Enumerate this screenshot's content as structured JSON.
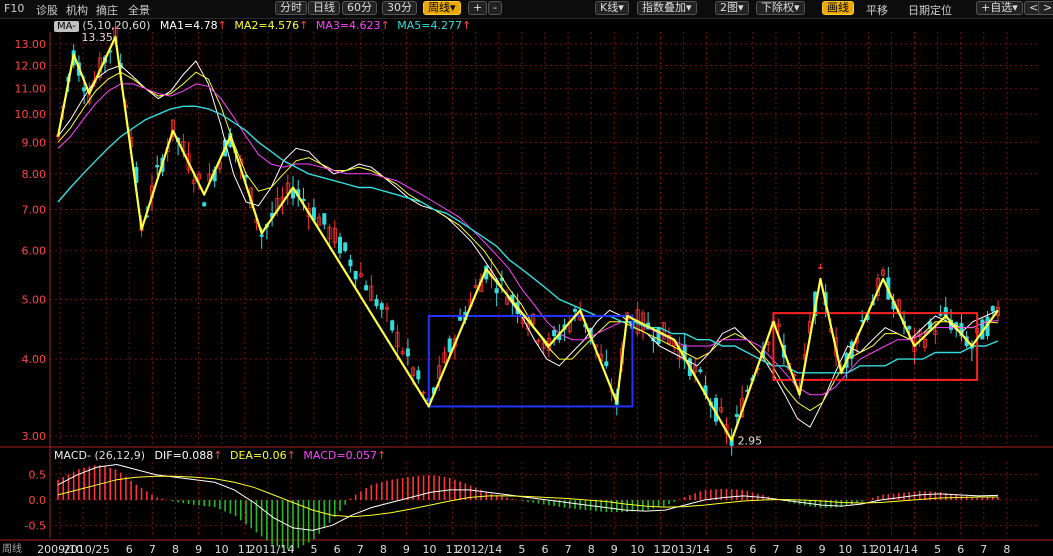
{
  "toolbar": {
    "left": [
      "F10",
      "诊股",
      "机构",
      "摘庄",
      "全景"
    ],
    "modes": [
      "分时",
      "日线",
      "60分",
      "30分"
    ],
    "period": "周线",
    "zoom": [
      "+",
      "-"
    ],
    "right": [
      {
        "label": "K线",
        "dropdown": true
      },
      {
        "label": "指数叠加",
        "dropdown": true
      },
      {
        "label": "2图",
        "dropdown": true
      },
      {
        "label": "下除权",
        "dropdown": true
      },
      {
        "label": "画线",
        "active": true
      },
      {
        "label": "平移"
      },
      {
        "label": "日期定位"
      },
      {
        "label": "+自选",
        "dropdown": true
      },
      {
        "label": "<"
      },
      {
        "label": ">"
      }
    ]
  },
  "ma_legend": {
    "tag": "MA-",
    "params": "(5,10,20,60)",
    "items": [
      {
        "label": "MA1=4.78",
        "color": "#ffffff"
      },
      {
        "label": "MA2=4.576",
        "color": "#ffff33"
      },
      {
        "label": "MA3=4.623",
        "color": "#ff44ff"
      },
      {
        "label": "MA5=4.277",
        "color": "#33dddd"
      }
    ]
  },
  "macd_legend": {
    "tag": "MACD-",
    "params": "(26,12,9)",
    "items": [
      {
        "label": "DIF=0.088",
        "color": "#ffffff"
      },
      {
        "label": "DEA=0.06",
        "color": "#ffff33"
      },
      {
        "label": "MACD=0.057",
        "color": "#ff44ff"
      }
    ]
  },
  "price_annotations": {
    "high": "13.35",
    "low": "2.95"
  },
  "bottom_label": "周线",
  "colors": {
    "up": "#ff3333",
    "down": "#33dddd",
    "zigzag": "#ffff44",
    "blue_box": "#2233ff",
    "red_box": "#ff2222",
    "grid": "#7a1010"
  },
  "chart_data": [
    {
      "type": "candlestick",
      "scale": "log",
      "ylim": [
        2.9,
        13.6
      ],
      "yticks": [
        "13.00",
        "12.00",
        "11.00",
        "10.00",
        "9.00",
        "8.00",
        "7.00",
        "6.00",
        "5.00",
        "4.00",
        "3.00"
      ],
      "ytick_values": [
        13,
        12,
        11,
        10,
        9,
        8,
        7,
        6,
        5,
        4,
        3
      ],
      "x_labels": [
        "2009/10",
        "2010/2",
        "5",
        "6",
        "7",
        "8",
        "9",
        "10",
        "11",
        "2011/1",
        "4",
        "5",
        "6",
        "7",
        "8",
        "9",
        "10",
        "11",
        "2012/1",
        "4",
        "5",
        "6",
        "7",
        "8",
        "9",
        "10",
        "11",
        "2013/1",
        "4",
        "5",
        "6",
        "7",
        "8",
        "9",
        "10",
        "11",
        "2014/1",
        "4",
        "5",
        "6",
        "7",
        "8"
      ],
      "series": [
        {
          "name": "MA1",
          "values": [
            9.2,
            9.8,
            10.6,
            11.4,
            11.8,
            12.0,
            11.5,
            11.0,
            10.6,
            10.9,
            11.6,
            12.2,
            11.2,
            9.6,
            8.0,
            7.2,
            7.1,
            7.6,
            8.4,
            8.8,
            8.7,
            8.3,
            8.0,
            8.1,
            8.3,
            8.2,
            7.9,
            7.6,
            7.3,
            7.1,
            7.0,
            6.8,
            6.5,
            6.2,
            5.8,
            5.4,
            5.0,
            4.7,
            4.3,
            4.0,
            3.9,
            4.1,
            4.3,
            4.6,
            4.8,
            4.7,
            4.5,
            4.4,
            4.2,
            4.1,
            4.0,
            3.9,
            4.1,
            4.4,
            4.5,
            4.3,
            4.1,
            3.8,
            3.5,
            3.2,
            3.1,
            3.4,
            3.8,
            4.2,
            4.1,
            4.3,
            4.5,
            4.4,
            4.3,
            4.5,
            4.7,
            4.6,
            4.4,
            4.6,
            4.7,
            4.8
          ]
        },
        {
          "name": "MA2",
          "values": [
            9.0,
            9.5,
            10.2,
            10.9,
            11.4,
            11.7,
            11.4,
            11.0,
            10.7,
            10.8,
            11.2,
            11.7,
            11.4,
            10.3,
            9.0,
            8.0,
            7.5,
            7.6,
            8.0,
            8.4,
            8.5,
            8.3,
            8.1,
            8.1,
            8.2,
            8.1,
            7.9,
            7.7,
            7.4,
            7.2,
            7.0,
            6.8,
            6.6,
            6.3,
            6.0,
            5.6,
            5.2,
            4.9,
            4.5,
            4.2,
            4.0,
            4.0,
            4.2,
            4.4,
            4.6,
            4.6,
            4.5,
            4.4,
            4.3,
            4.2,
            4.1,
            4.0,
            4.1,
            4.3,
            4.4,
            4.3,
            4.1,
            3.9,
            3.6,
            3.4,
            3.3,
            3.4,
            3.7,
            4.0,
            4.1,
            4.2,
            4.4,
            4.4,
            4.3,
            4.4,
            4.6,
            4.6,
            4.5,
            4.5,
            4.6,
            4.58
          ]
        },
        {
          "name": "MA3",
          "values": [
            8.8,
            9.2,
            9.8,
            10.4,
            10.9,
            11.2,
            11.2,
            11.0,
            10.8,
            10.7,
            10.9,
            11.2,
            11.1,
            10.6,
            9.9,
            9.2,
            8.6,
            8.3,
            8.2,
            8.3,
            8.3,
            8.2,
            8.1,
            8.0,
            8.0,
            8.0,
            7.9,
            7.8,
            7.6,
            7.4,
            7.2,
            7.0,
            6.8,
            6.5,
            6.2,
            5.9,
            5.6,
            5.2,
            4.9,
            4.6,
            4.4,
            4.3,
            4.3,
            4.4,
            4.5,
            4.6,
            4.6,
            4.5,
            4.4,
            4.3,
            4.2,
            4.2,
            4.2,
            4.3,
            4.3,
            4.3,
            4.2,
            4.0,
            3.8,
            3.6,
            3.5,
            3.5,
            3.6,
            3.8,
            4.0,
            4.1,
            4.2,
            4.3,
            4.3,
            4.4,
            4.5,
            4.5,
            4.5,
            4.5,
            4.6,
            4.62
          ]
        },
        {
          "name": "MA5",
          "values": [
            7.2,
            7.6,
            8.0,
            8.4,
            8.8,
            9.2,
            9.5,
            9.8,
            10.0,
            10.2,
            10.3,
            10.3,
            10.2,
            10.0,
            9.7,
            9.4,
            9.0,
            8.7,
            8.4,
            8.2,
            8.0,
            7.9,
            7.8,
            7.7,
            7.6,
            7.6,
            7.5,
            7.4,
            7.3,
            7.2,
            7.0,
            6.9,
            6.7,
            6.5,
            6.3,
            6.1,
            5.8,
            5.6,
            5.4,
            5.2,
            5.0,
            4.9,
            4.8,
            4.7,
            4.7,
            4.6,
            4.6,
            4.5,
            4.5,
            4.4,
            4.4,
            4.3,
            4.3,
            4.2,
            4.2,
            4.1,
            4.0,
            3.9,
            3.9,
            3.8,
            3.8,
            3.8,
            3.8,
            3.8,
            3.9,
            3.9,
            3.9,
            4.0,
            4.0,
            4.0,
            4.1,
            4.1,
            4.1,
            4.2,
            4.2,
            4.28
          ]
        }
      ],
      "zigzag": [
        [
          0,
          9.2
        ],
        [
          3,
          12.5
        ],
        [
          6,
          10.8
        ],
        [
          11,
          13.35
        ],
        [
          16,
          6.5
        ],
        [
          22,
          9.4
        ],
        [
          28,
          7.4
        ],
        [
          33,
          9.2
        ],
        [
          39,
          6.4
        ],
        [
          45,
          7.6
        ],
        [
          71,
          3.35
        ],
        [
          82,
          5.6
        ],
        [
          94,
          4.2
        ],
        [
          100,
          4.8
        ],
        [
          107,
          3.4
        ],
        [
          109,
          4.7
        ],
        [
          118,
          4.3
        ],
        [
          129,
          2.95
        ],
        [
          137,
          4.6
        ],
        [
          142,
          3.5
        ],
        [
          146,
          5.4
        ],
        [
          150,
          3.8
        ],
        [
          158,
          5.4
        ],
        [
          164,
          4.2
        ],
        [
          170,
          4.7
        ],
        [
          175,
          4.2
        ],
        [
          180,
          4.8
        ]
      ],
      "boxes": [
        {
          "x": [
            71,
            110
          ],
          "y": [
            3.35,
            4.7
          ],
          "color": "blue"
        },
        {
          "x": [
            137,
            176
          ],
          "y": [
            3.7,
            4.75
          ],
          "color": "red"
        }
      ]
    },
    {
      "type": "macd",
      "ylim": [
        -0.75,
        0.75
      ],
      "yticks": [
        "0.5",
        "0.0",
        "-0.5"
      ],
      "ytick_values": [
        0.5,
        0.0,
        -0.5
      ],
      "dif": [
        0.3,
        0.5,
        0.65,
        0.7,
        0.6,
        0.5,
        0.45,
        0.4,
        0.35,
        0.2,
        -0.05,
        -0.35,
        -0.55,
        -0.6,
        -0.5,
        -0.3,
        -0.15,
        -0.05,
        0.05,
        0.15,
        0.2,
        0.2,
        0.15,
        0.1,
        0.05,
        0.0,
        -0.05,
        -0.1,
        -0.15,
        -0.2,
        -0.22,
        -0.2,
        -0.1,
        0.0,
        0.05,
        0.08,
        0.05,
        0.0,
        -0.05,
        -0.1,
        -0.12,
        -0.08,
        0.0,
        0.05,
        0.1,
        0.12,
        0.1,
        0.08,
        0.09
      ],
      "dea": [
        0.1,
        0.2,
        0.3,
        0.4,
        0.45,
        0.47,
        0.47,
        0.45,
        0.42,
        0.35,
        0.25,
        0.1,
        -0.05,
        -0.2,
        -0.3,
        -0.33,
        -0.3,
        -0.25,
        -0.18,
        -0.1,
        -0.02,
        0.05,
        0.08,
        0.08,
        0.07,
        0.05,
        0.03,
        0.0,
        -0.03,
        -0.08,
        -0.12,
        -0.14,
        -0.13,
        -0.1,
        -0.06,
        -0.02,
        0.0,
        0.01,
        0.0,
        -0.02,
        -0.05,
        -0.06,
        -0.05,
        -0.02,
        0.01,
        0.04,
        0.05,
        0.06,
        0.06
      ]
    }
  ]
}
